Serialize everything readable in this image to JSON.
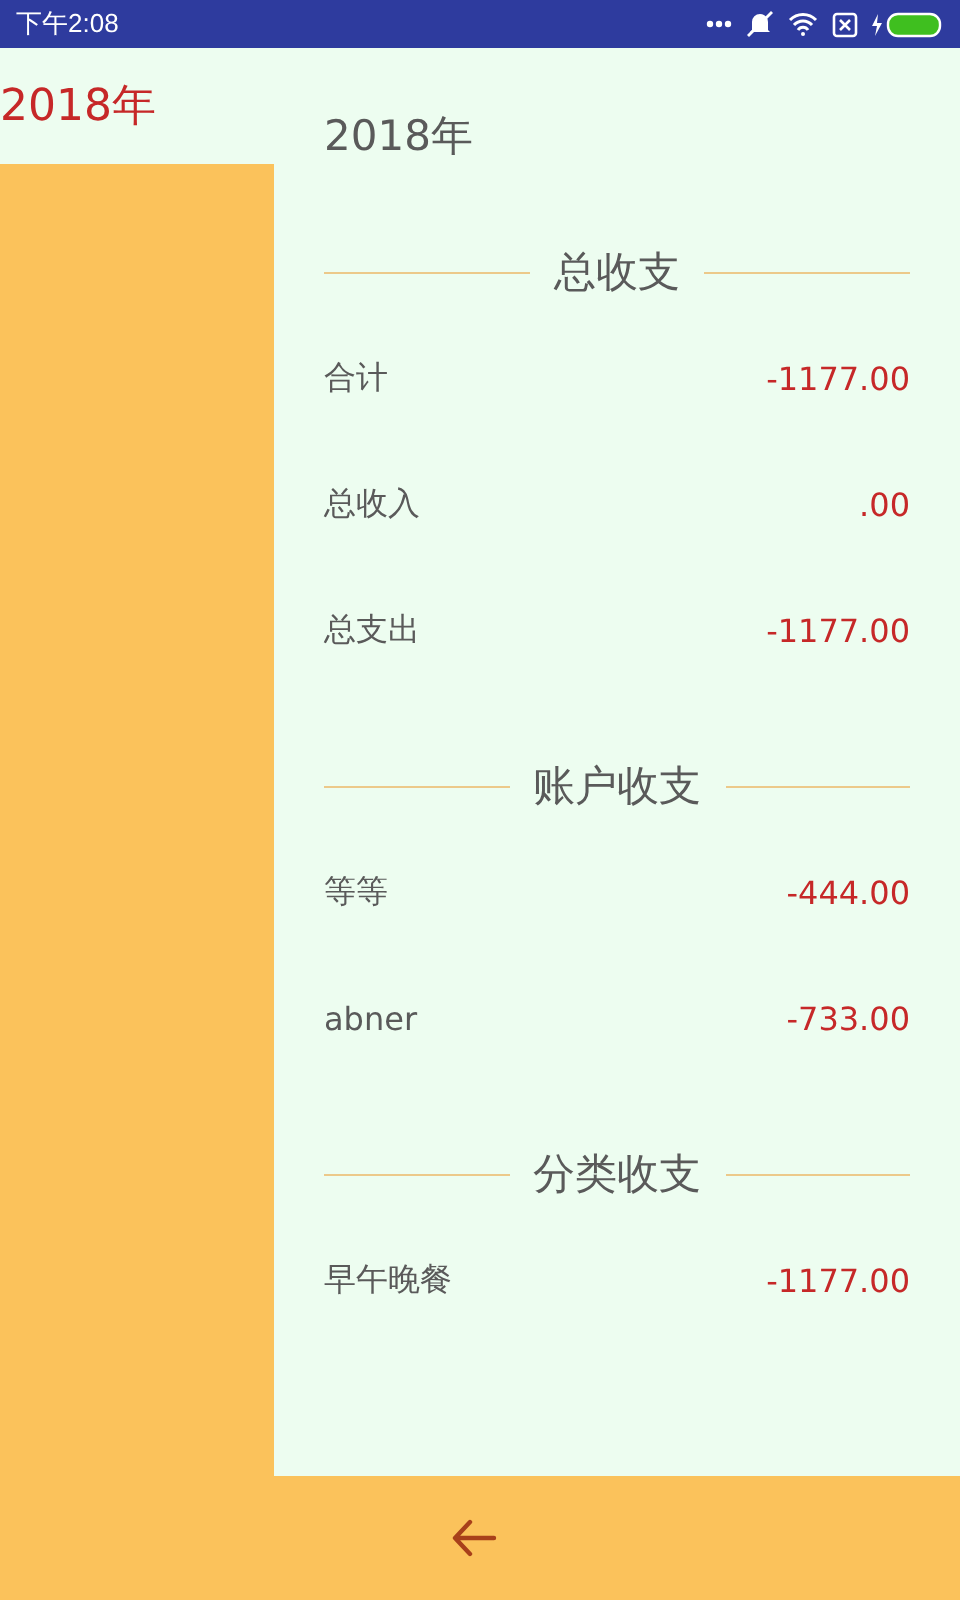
{
  "status_bar": {
    "time": "下午2:08"
  },
  "years": [
    {
      "label": "2018年",
      "selected": true
    }
  ],
  "detail": {
    "title": "2018年",
    "sections": [
      {
        "heading": "总收支",
        "rows": [
          {
            "label": "合计",
            "amount": "-1177.00"
          },
          {
            "label": "总收入",
            "amount": ".00"
          },
          {
            "label": "总支出",
            "amount": "-1177.00"
          }
        ]
      },
      {
        "heading": "账户收支",
        "rows": [
          {
            "label": "等等",
            "amount": "-444.00"
          },
          {
            "label": "abner",
            "amount": "-733.00"
          }
        ]
      },
      {
        "heading": "分类收支",
        "rows": [
          {
            "label": "早午晚餐",
            "amount": "-1177.00"
          }
        ]
      }
    ]
  }
}
